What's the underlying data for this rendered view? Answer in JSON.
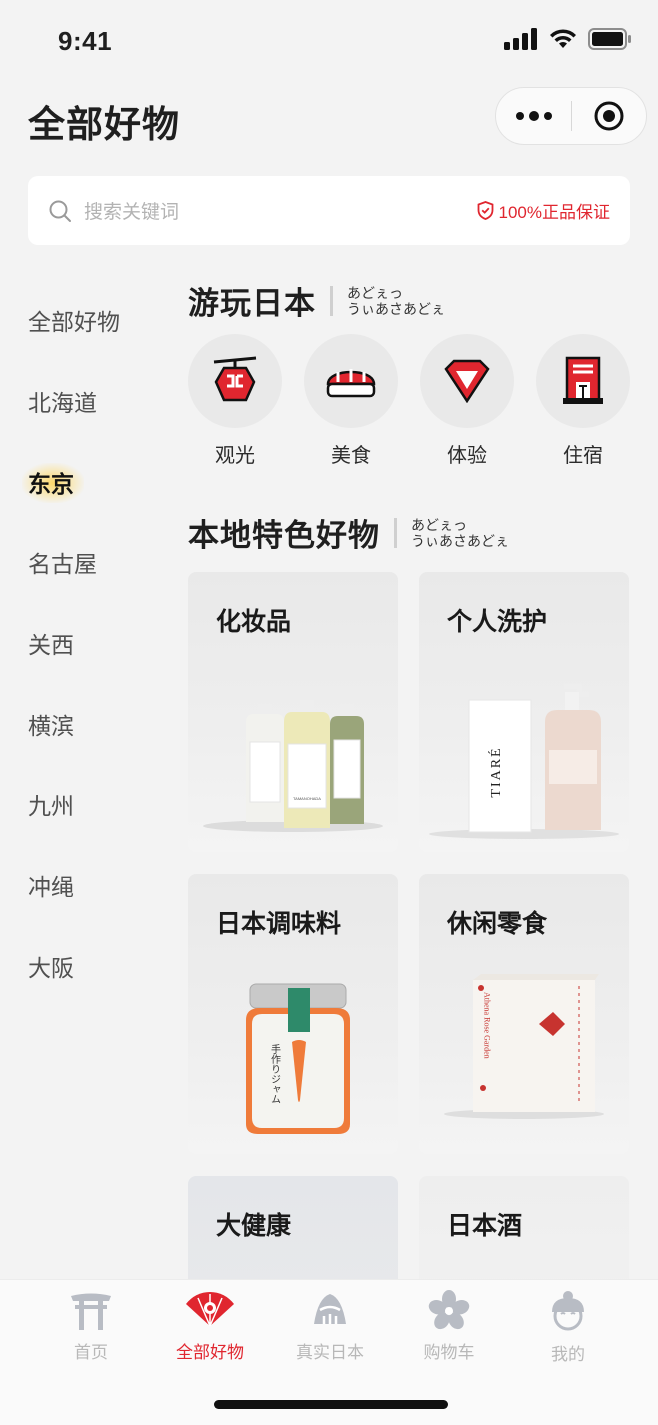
{
  "status": {
    "time": "9:41"
  },
  "header": {
    "title": "全部好物"
  },
  "search": {
    "placeholder": "搜索关键词",
    "guarantee": "100%正品保证"
  },
  "sidebar": {
    "items": [
      {
        "label": "全部好物"
      },
      {
        "label": "北海道"
      },
      {
        "label": "东京",
        "active": true
      },
      {
        "label": "名古屋"
      },
      {
        "label": "关西"
      },
      {
        "label": "横滨"
      },
      {
        "label": "九州"
      },
      {
        "label": "冲绳"
      },
      {
        "label": "大阪"
      }
    ]
  },
  "sections": {
    "travel": {
      "title": "游玩日本",
      "kana_line1": "あどぇっ",
      "kana_line2": "うぃあさあどぇ"
    },
    "local": {
      "title": "本地特色好物",
      "kana_line1": "あどぇっ",
      "kana_line2": "うぃあさあどぇ"
    }
  },
  "categories": [
    {
      "label": "观光",
      "icon": "ropeway-icon"
    },
    {
      "label": "美食",
      "icon": "sushi-icon"
    },
    {
      "label": "体验",
      "icon": "gem-icon"
    },
    {
      "label": "住宿",
      "icon": "hotel-icon"
    }
  ],
  "products": [
    {
      "title": "化妆品"
    },
    {
      "title": "个人洗护"
    },
    {
      "title": "日本调味料"
    },
    {
      "title": "休闲零食"
    },
    {
      "title": "大健康"
    },
    {
      "title": "日本酒"
    }
  ],
  "product_art_text": {
    "bottle_brand": "TAMANOHADA",
    "tiare_box": "TIARÉ",
    "jam_label": "手作りジャム",
    "snack_brand": "Athena Rose Garden"
  },
  "tabbar": {
    "tabs": [
      {
        "label": "首页",
        "icon": "torii-icon"
      },
      {
        "label": "全部好物",
        "icon": "fan-icon",
        "active": true
      },
      {
        "label": "真实日本",
        "icon": "mountain-icon"
      },
      {
        "label": "购物车",
        "icon": "sakura-icon"
      },
      {
        "label": "我的",
        "icon": "geisha-icon"
      }
    ]
  },
  "colors": {
    "accent": "#e0262f",
    "active_glow": "#ffd24a",
    "background": "#f3f3f3"
  }
}
